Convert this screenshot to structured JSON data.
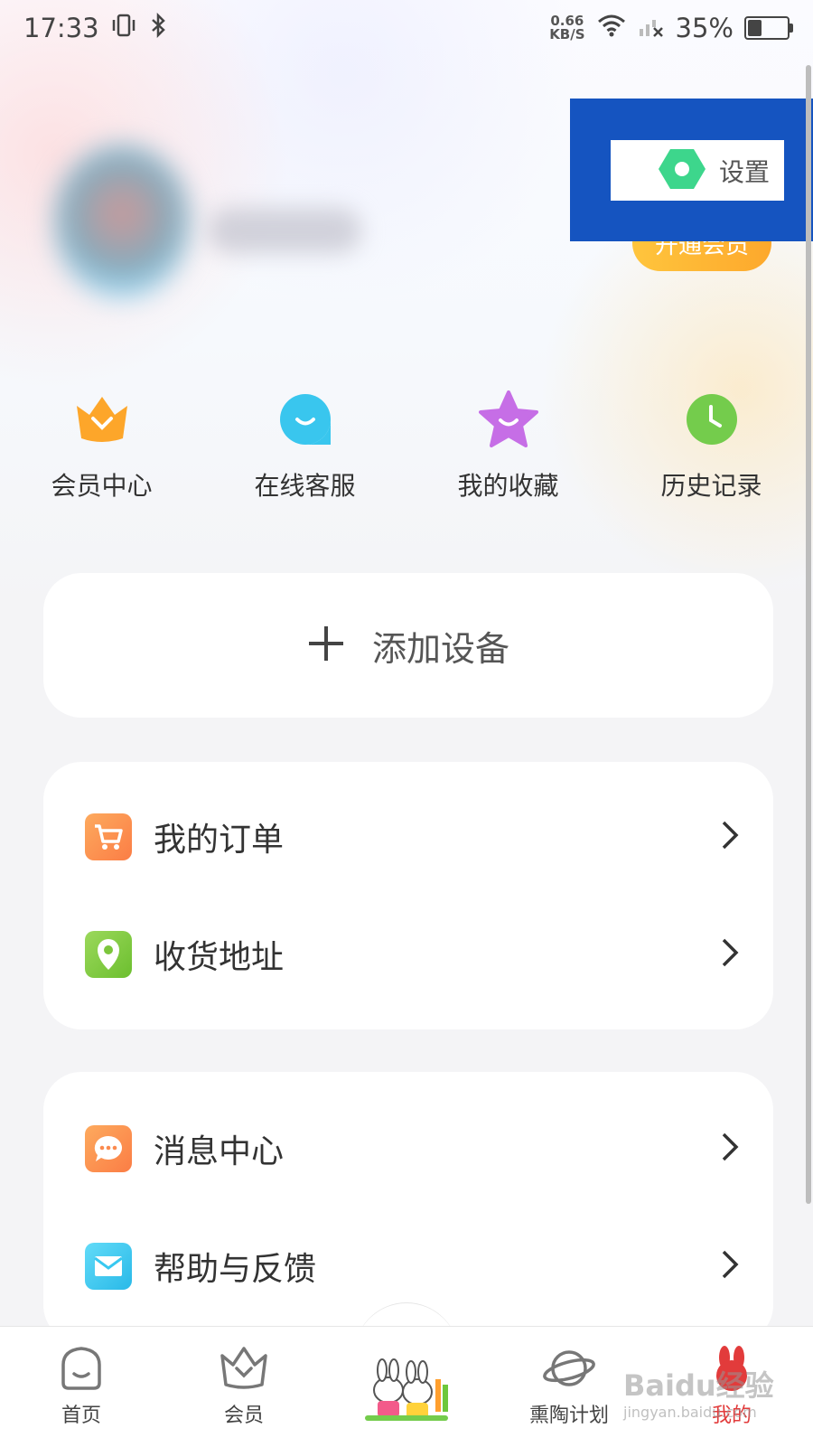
{
  "status_bar": {
    "time": "17:33",
    "net_speed_value": "0.66",
    "net_speed_unit": "KB/S",
    "battery_percent": "35%",
    "battery_level": 0.35
  },
  "header": {
    "settings_label": "设置",
    "vip_button_label": "开通会员"
  },
  "quick_actions": [
    {
      "label": "会员中心",
      "icon": "crown-icon"
    },
    {
      "label": "在线客服",
      "icon": "chat-smile-icon"
    },
    {
      "label": "我的收藏",
      "icon": "star-icon"
    },
    {
      "label": "历史记录",
      "icon": "clock-icon"
    }
  ],
  "add_device": {
    "label": "添加设备"
  },
  "menu_group_1": [
    {
      "label": "我的订单",
      "icon": "cart-icon",
      "color": "#fb8a4e"
    },
    {
      "label": "收货地址",
      "icon": "location-pin-icon",
      "color": "#7cc63c"
    }
  ],
  "menu_group_2": [
    {
      "label": "消息中心",
      "icon": "message-bubble-icon",
      "color": "#fb8a4e"
    },
    {
      "label": "帮助与反馈",
      "icon": "mail-icon",
      "color": "#38c8f0"
    }
  ],
  "bottom_nav": [
    {
      "label": "首页",
      "icon": "home-icon"
    },
    {
      "label": "会员",
      "icon": "crown-outline-icon"
    },
    {
      "label": "",
      "icon": "bunny-mascot-icon"
    },
    {
      "label": "熏陶计划",
      "icon": "planet-icon"
    },
    {
      "label": "我的",
      "icon": "bunny-profile-icon",
      "active": true
    }
  ],
  "colors": {
    "accent_red": "#e23b3b",
    "settings_highlight": "#1554c0",
    "vip_orange": "#fda82c"
  },
  "watermark": {
    "text": "Baidu经验",
    "sub": "jingyan.baidu.com"
  }
}
